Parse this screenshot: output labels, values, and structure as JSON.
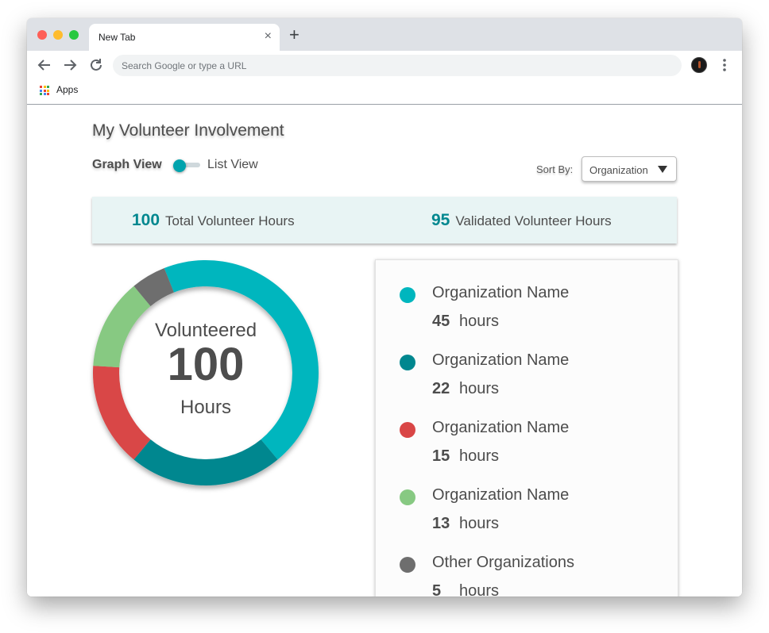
{
  "browser": {
    "tab_title": "New Tab",
    "tab_close": "×",
    "new_tab": "+",
    "omnibox_placeholder": "Search Google or type a URL",
    "bookmark_apps": "Apps"
  },
  "page": {
    "title": "My Volunteer Involvement",
    "toggle": {
      "left_label": "Graph View",
      "right_label": "List View",
      "selected": "Graph View"
    },
    "sort": {
      "label": "Sort By:",
      "value": "Organization"
    },
    "summary": {
      "total_hours": "100",
      "total_label": "Total Volunteer Hours",
      "validated_hours": "95",
      "validated_label": "Validated Volunteer Hours"
    },
    "donut_center": {
      "top": "Volunteered",
      "value": "100",
      "bottom": "Hours"
    }
  },
  "colors": {
    "teal_light": "#00b6be",
    "teal_dark": "#00878f",
    "red": "#d94646",
    "green": "#87c982",
    "gray": "#6e6e6e"
  },
  "chart_data": {
    "type": "pie",
    "categories": [
      "Organization Name",
      "Organization Name",
      "Organization Name",
      "Organization Name",
      "Other Organizations"
    ],
    "values": [
      45,
      22,
      15,
      13,
      5
    ],
    "colors": [
      "#00b6be",
      "#00878f",
      "#d94646",
      "#87c982",
      "#6e6e6e"
    ],
    "title": "",
    "legend": "right"
  },
  "legend_items": [
    {
      "name": "Organization Name",
      "hours": "45",
      "unit": "hours",
      "color": "#00b6be"
    },
    {
      "name": "Organization Name",
      "hours": "22",
      "unit": "hours",
      "color": "#00878f"
    },
    {
      "name": "Organization Name",
      "hours": "15",
      "unit": "hours",
      "color": "#d94646"
    },
    {
      "name": "Organization Name",
      "hours": "13",
      "unit": "hours",
      "color": "#87c982"
    },
    {
      "name": "Other Organizations",
      "hours": "5",
      "unit": "hours",
      "color": "#6e6e6e"
    }
  ]
}
